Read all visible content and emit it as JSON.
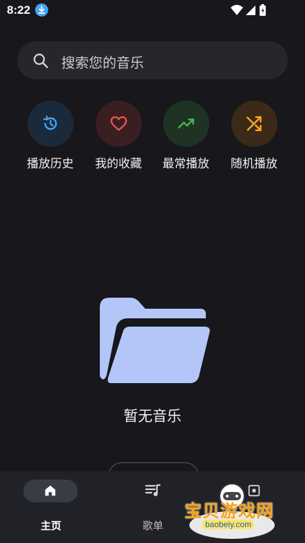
{
  "status_bar": {
    "time": "8:22"
  },
  "search": {
    "placeholder": "搜索您的音乐"
  },
  "quick_actions": [
    {
      "label": "播放历史",
      "icon": "history-icon",
      "color": "#42a5f5",
      "bg": "#1b2a3a"
    },
    {
      "label": "我的收藏",
      "icon": "heart-icon",
      "color": "#ef5350",
      "bg": "#3a1f22"
    },
    {
      "label": "最常播放",
      "icon": "trending-up-icon",
      "color": "#4caf50",
      "bg": "#1e3323"
    },
    {
      "label": "随机播放",
      "icon": "shuffle-icon",
      "color": "#ffa726",
      "bg": "#3b2a17"
    }
  ],
  "empty_state": {
    "icon": "folder-open-icon",
    "text": "暂无音乐",
    "icon_color": "#b3c6f7"
  },
  "bottom_nav": [
    {
      "label": "主页",
      "icon": "home-icon",
      "active": true
    },
    {
      "label": "歌单",
      "icon": "playlist-icon",
      "active": false
    },
    {
      "label": "",
      "icon": "album-icon",
      "active": false
    }
  ],
  "watermark": {
    "text": "宝贝游戏网",
    "url": "baobeiy.com"
  }
}
